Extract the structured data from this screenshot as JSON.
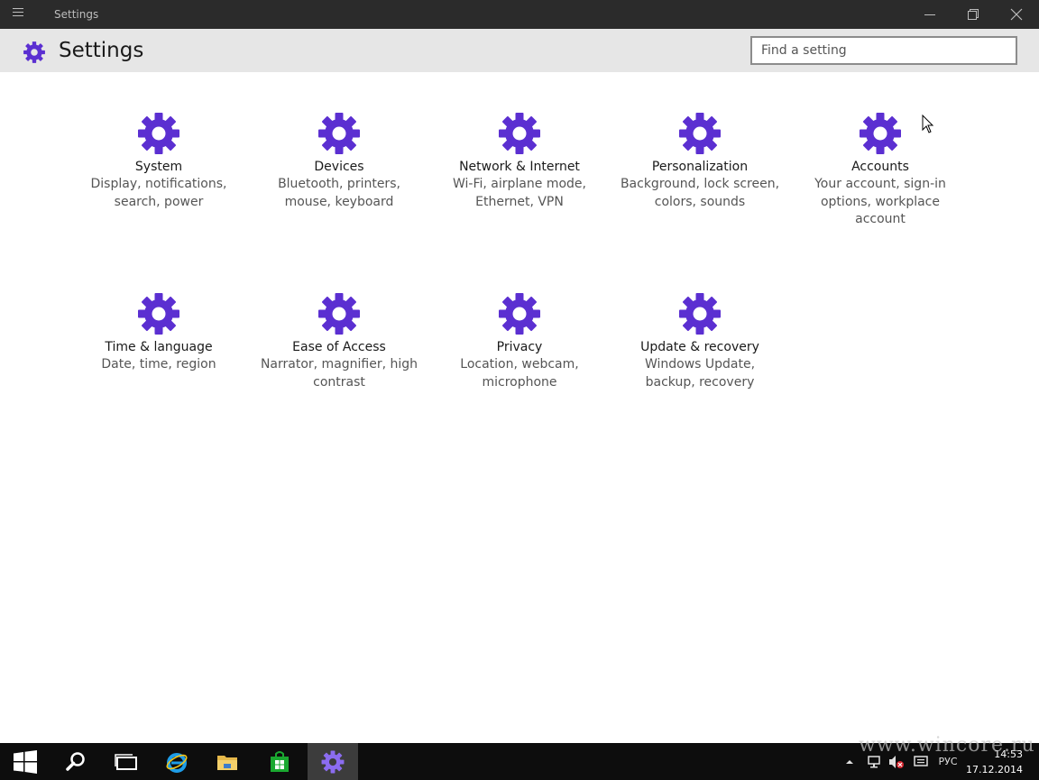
{
  "window": {
    "title": "Settings",
    "menu_icon": "hamburger-icon",
    "minimize_icon": "minimize-icon",
    "restore_icon": "restore-icon",
    "close_icon": "close-icon"
  },
  "header": {
    "title": "Settings",
    "icon": "gear-icon",
    "search_placeholder": "Find a setting"
  },
  "colors": {
    "accent": "#5b2fd1",
    "titlebar": "#2b2b2b",
    "header_bg": "#e6e6e6",
    "taskbar": "#0d0d0d"
  },
  "categories": [
    {
      "name": "System",
      "desc_lines": [
        "Display, notifications,",
        "search, power"
      ]
    },
    {
      "name": "Devices",
      "desc_lines": [
        "Bluetooth, printers,",
        "mouse, keyboard"
      ]
    },
    {
      "name": "Network & Internet",
      "desc_lines": [
        "Wi-Fi, airplane mode,",
        "Ethernet, VPN"
      ]
    },
    {
      "name": "Personalization",
      "desc_lines": [
        "Background, lock screen,",
        "colors, sounds"
      ]
    },
    {
      "name": "Accounts",
      "desc_lines": [
        "Your account, sign-in",
        "options, workplace",
        "account"
      ]
    },
    {
      "name": "Time & language",
      "desc_lines": [
        "Date, time, region"
      ]
    },
    {
      "name": "Ease of Access",
      "desc_lines": [
        "Narrator, magnifier, high",
        "contrast"
      ]
    },
    {
      "name": "Privacy",
      "desc_lines": [
        "Location, webcam,",
        "microphone"
      ]
    },
    {
      "name": "Update & recovery",
      "desc_lines": [
        "Windows Update,",
        "backup, recovery"
      ]
    }
  ],
  "taskbar": {
    "items": [
      "start-icon",
      "search-icon",
      "task-view-icon",
      "ie-icon",
      "file-explorer-icon",
      "store-icon",
      "settings-icon"
    ],
    "tray": {
      "language": "РУС",
      "time": "14:53",
      "date": "17.12.2014"
    }
  },
  "watermark": "www.wincore.ru"
}
